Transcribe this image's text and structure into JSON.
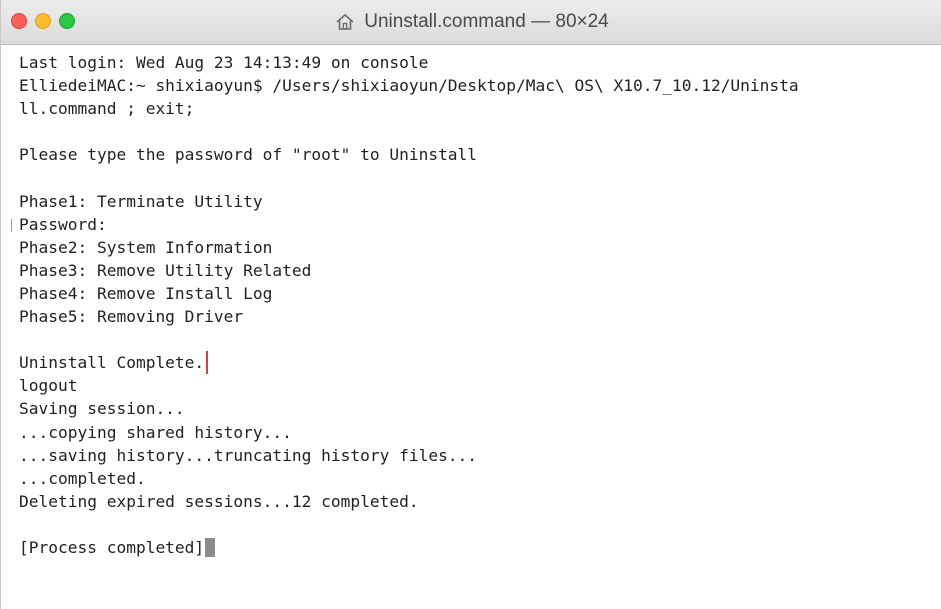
{
  "window": {
    "title": "Uninstall.command — 80×24",
    "title_icon": "home-icon"
  },
  "terminal": {
    "lines": [
      "Last login: Wed Aug 23 14:13:49 on console",
      "ElliedeiMAC:~ shixiaoyun$ /Users/shixiaoyun/Desktop/Mac\\ OS\\ X10.7_10.12/Uninsta",
      "ll.command ; exit;",
      "",
      "Please type the password of \"root\" to Uninstall",
      "",
      "Phase1: Terminate Utility",
      "Password:",
      "Phase2: System Information",
      "Phase3: Remove Utility Related",
      "Phase4: Remove Install Log",
      "Phase5: Removing Driver",
      "",
      "Uninstall Complete.",
      "logout",
      "Saving session...",
      "...copying shared history...",
      "...saving history...truncating history files...",
      "...completed.",
      "Deleting expired sessions...12 completed.",
      "",
      "[Process completed]"
    ]
  },
  "colors": {
    "highlight": "#c9463d",
    "text": "#222222"
  }
}
